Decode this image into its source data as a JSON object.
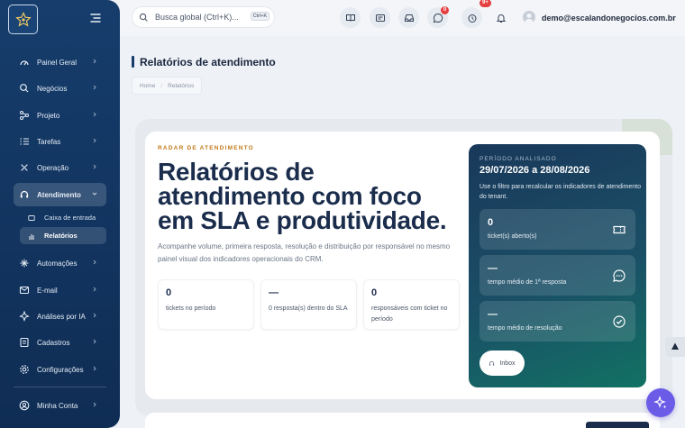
{
  "sidebar": {
    "items": [
      {
        "label": "Painel Geral",
        "icon": "dashboard-icon"
      },
      {
        "label": "Negócios",
        "icon": "search-icon"
      },
      {
        "label": "Projeto",
        "icon": "project-icon"
      },
      {
        "label": "Tarefas",
        "icon": "tasks-icon"
      },
      {
        "label": "Operação",
        "icon": "operation-icon"
      },
      {
        "label": "Atendimento",
        "icon": "headset-icon"
      },
      {
        "label": "Automações",
        "icon": "automation-icon"
      },
      {
        "label": "E-mail",
        "icon": "email-icon"
      },
      {
        "label": "Análises por IA",
        "icon": "ai-icon"
      },
      {
        "label": "Cadastros",
        "icon": "records-icon"
      },
      {
        "label": "Configurações",
        "icon": "settings-icon"
      }
    ],
    "subitems": [
      {
        "label": "Caixa de entrada"
      },
      {
        "label": "Relatórios"
      }
    ],
    "account_label": "Minha Conta"
  },
  "topbar": {
    "search_placeholder": "Busca global (Ctrl+K)...",
    "search_shortcut": "Ctrl+K",
    "whatsapp_badge": "0",
    "notifications_badge": "9+",
    "user_email": "demo@escalandonegocios.com.br"
  },
  "page": {
    "title": "Relatórios de atendimento",
    "breadcrumb": [
      "Home",
      "Relatórios"
    ]
  },
  "hero": {
    "eyebrow": "RADAR DE ATENDIMENTO",
    "title": "Relatórios de atendimento com foco em SLA e produtividade.",
    "description": "Acompanhe volume, primeira resposta, resolução e distribuição por responsável no mesmo painel visual dos indicadores operacionais do CRM.",
    "stats": [
      {
        "value": "0",
        "label": "tickets no período"
      },
      {
        "value": "—",
        "label": "0 resposta(s) dentro do SLA"
      },
      {
        "value": "0",
        "label": "responsáveis com ticket no período"
      }
    ]
  },
  "period_panel": {
    "eyebrow": "PERÍODO ANALISADO",
    "period": "29/07/2026 a 28/08/2026",
    "description": "Use o filtro para recalcular os indicadores de atendimento do tenant.",
    "cards": [
      {
        "value": "0",
        "label": "ticket(s) aberto(s)",
        "icon": "ticket-icon"
      },
      {
        "value": "—",
        "label": "tempo médio de 1ª resposta",
        "icon": "chat-icon"
      },
      {
        "value": "—",
        "label": "tempo médio de resolução",
        "icon": "check-circle-icon"
      }
    ],
    "inbox_button": "Inbox"
  },
  "colors": {
    "sidebar": "#163d6c",
    "accent_eyebrow": "#c27a1a",
    "panel_gradient_end": "#127164",
    "badge": "#e53e3e",
    "fab": "#6b5ce7"
  }
}
